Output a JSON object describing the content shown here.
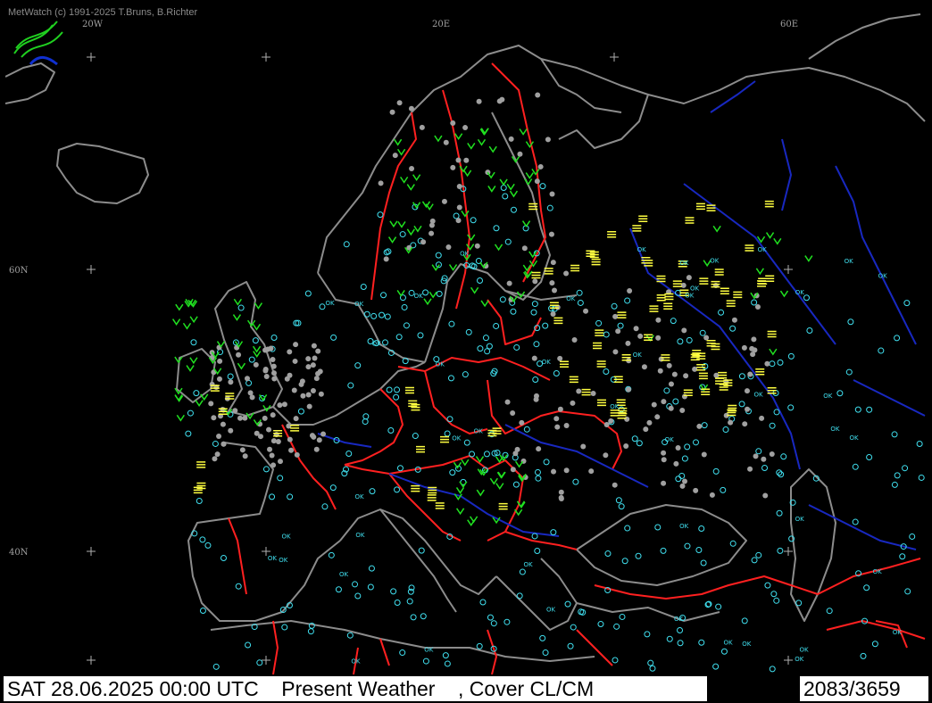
{
  "app": {
    "copyright": "MetWatch  (c) 1991-2025 T.Bruns, B.Richter"
  },
  "map": {
    "grid_labels": [
      "20W",
      "20E",
      "60E",
      "60N",
      "40N"
    ],
    "icon_name": "metwatch-logo-icon",
    "colors": {
      "background": "#000000",
      "coastline": "#8c8c8c",
      "borders": "#ff2020",
      "rivers": "#1020c0",
      "cloud_cover_open": "#40e0f0",
      "precipitation": "#20e020",
      "fog_haze": "#ffff40",
      "overcast": "#a0a0a0"
    },
    "station_label": "OK"
  },
  "status": {
    "datetime": "SAT 28.06.2025 00:00 UTC",
    "product": "Present Weather",
    "overlay": ", Cover CL/CM",
    "count": "2083/3659"
  }
}
